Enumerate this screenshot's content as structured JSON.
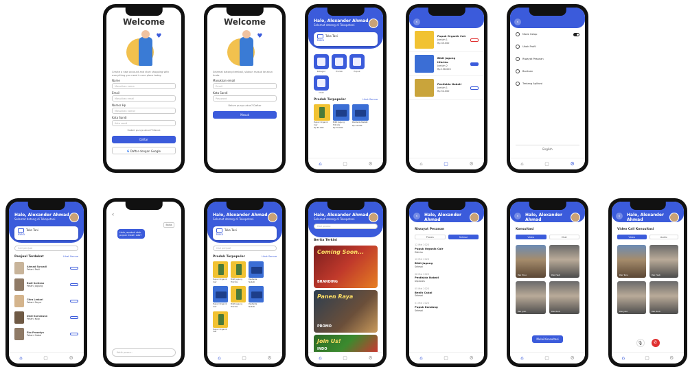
{
  "colors": {
    "primary": "#3b5bdb",
    "danger": "#e03131",
    "accent": "#f1c232"
  },
  "register": {
    "title": "Welcome",
    "intro": "Create a new account and start shopping with everything you need in one place today.",
    "fields": [
      {
        "label": "Name",
        "placeholder": "Masukkan nama"
      },
      {
        "label": "Email",
        "placeholder": "Masukkan email"
      },
      {
        "label": "Nomor Hp",
        "placeholder": "Masukkan nomor"
      },
      {
        "label": "Kata Sandi",
        "placeholder": "Kata sandi"
      }
    ],
    "link": "Sudah punya akun? Masuk",
    "submit": "Daftar",
    "google": "Daftar dengan Google"
  },
  "login": {
    "title": "Welcome",
    "intro": "Selamat datang kembali, silakan masuk ke akun Anda.",
    "fields": [
      {
        "label": "Masukkan email",
        "placeholder": "Email"
      },
      {
        "label": "Kata Sandi",
        "placeholder": "Password"
      }
    ],
    "link": "Belum punya akun? Daftar",
    "submit": "Masuk"
  },
  "header": {
    "title": "Halo, Alexander Ahmad",
    "subtitle": "Selamat datang di Tokopetani"
  },
  "store_card": {
    "name": "Toko Tani",
    "sub": "Buka"
  },
  "categories": [
    "Kategori",
    "Produk",
    "Pupuk",
    "Obat"
  ],
  "products_header": {
    "title": "Produk Terpopuler",
    "more": "Lihat Semua"
  },
  "products": [
    {
      "name": "Pupuk Organik Cair",
      "price": "Rp 45.000"
    },
    {
      "name": "Bibit Jagung Hibrida",
      "price": "Rp 78.000"
    },
    {
      "name": "Pestisida Nabati",
      "price": "Rp 52.000"
    }
  ],
  "cart_items": [
    {
      "name": "Pupuk Organik Cair",
      "meta": "Jumlah 1",
      "price": "Rp 45.000"
    },
    {
      "name": "Bibit Jagung Hibrida",
      "meta": "Jumlah 2",
      "price": "Rp 156.000"
    },
    {
      "name": "Pestisida Nabati",
      "meta": "Jumlah 1",
      "price": "Rp 52.000"
    }
  ],
  "settings": {
    "items": [
      "Mode Gelap",
      "Ubah Profil",
      "Riwayat Pesanan",
      "Bantuan",
      "Tentang Aplikasi"
    ],
    "language": "English"
  },
  "sellers": {
    "search": "Cari penjual",
    "title": "Penjual Terdekat",
    "more": "Lihat Semua",
    "list": [
      {
        "name": "Ahmad Suryadi",
        "meta": "Petani Padi"
      },
      {
        "name": "Budi Santoso",
        "meta": "Petani Jagung"
      },
      {
        "name": "Citra Lestari",
        "meta": "Petani Sayur"
      },
      {
        "name": "Dedi Kurniawan",
        "meta": "Petani Kopi"
      },
      {
        "name": "Eko Prasetyo",
        "meta": "Petani Cabai"
      }
    ]
  },
  "chat": {
    "message": "Halo, apakah stok pupuk masih ada?",
    "reply_btn": "Balas",
    "placeholder": "Ketik pesan..."
  },
  "promo": {
    "search": "Cari promo",
    "title": "Berita Terkini",
    "banners": [
      {
        "title": "Coming Soon...",
        "sub": "BRANDING"
      },
      {
        "title": "Panen Raya",
        "sub": "PROMO"
      },
      {
        "title": "Join Us!",
        "sub": "INDO"
      }
    ]
  },
  "history": {
    "title": "Riwayat Pesanan",
    "tabs": [
      "Proses",
      "Selesai"
    ],
    "items": [
      {
        "name": "Pupuk Organik Cair",
        "meta": "12 Mei 2023",
        "status": "Dikirim"
      },
      {
        "name": "Bibit Jagung",
        "meta": "10 Mei 2023",
        "status": "Selesai"
      },
      {
        "name": "Pestisida Nabati",
        "meta": "08 Mei 2023",
        "status": "Diproses"
      },
      {
        "name": "Benih Cabai",
        "meta": "05 Mei 2023",
        "status": "Selesai"
      },
      {
        "name": "Pupuk Kandang",
        "meta": "01 Mei 2023",
        "status": "Selesai"
      }
    ]
  },
  "video": {
    "title": "Konsultasi",
    "tabs": [
      "Video",
      "Chat"
    ],
    "experts": [
      "Pak Tono",
      "Pak Hadi",
      "Pak Joko",
      "Pak Rudi"
    ],
    "start": "Mulai Konsultasi"
  },
  "call": {
    "title": "Video Call Konsultasi",
    "tabs": [
      "Video",
      "Audio"
    ],
    "experts": [
      "Pak Tono",
      "Pak Hadi",
      "Pak Joko",
      "Pak Rudi"
    ]
  },
  "nav": [
    "Beranda",
    "Pesanan",
    "Pengaturan"
  ]
}
